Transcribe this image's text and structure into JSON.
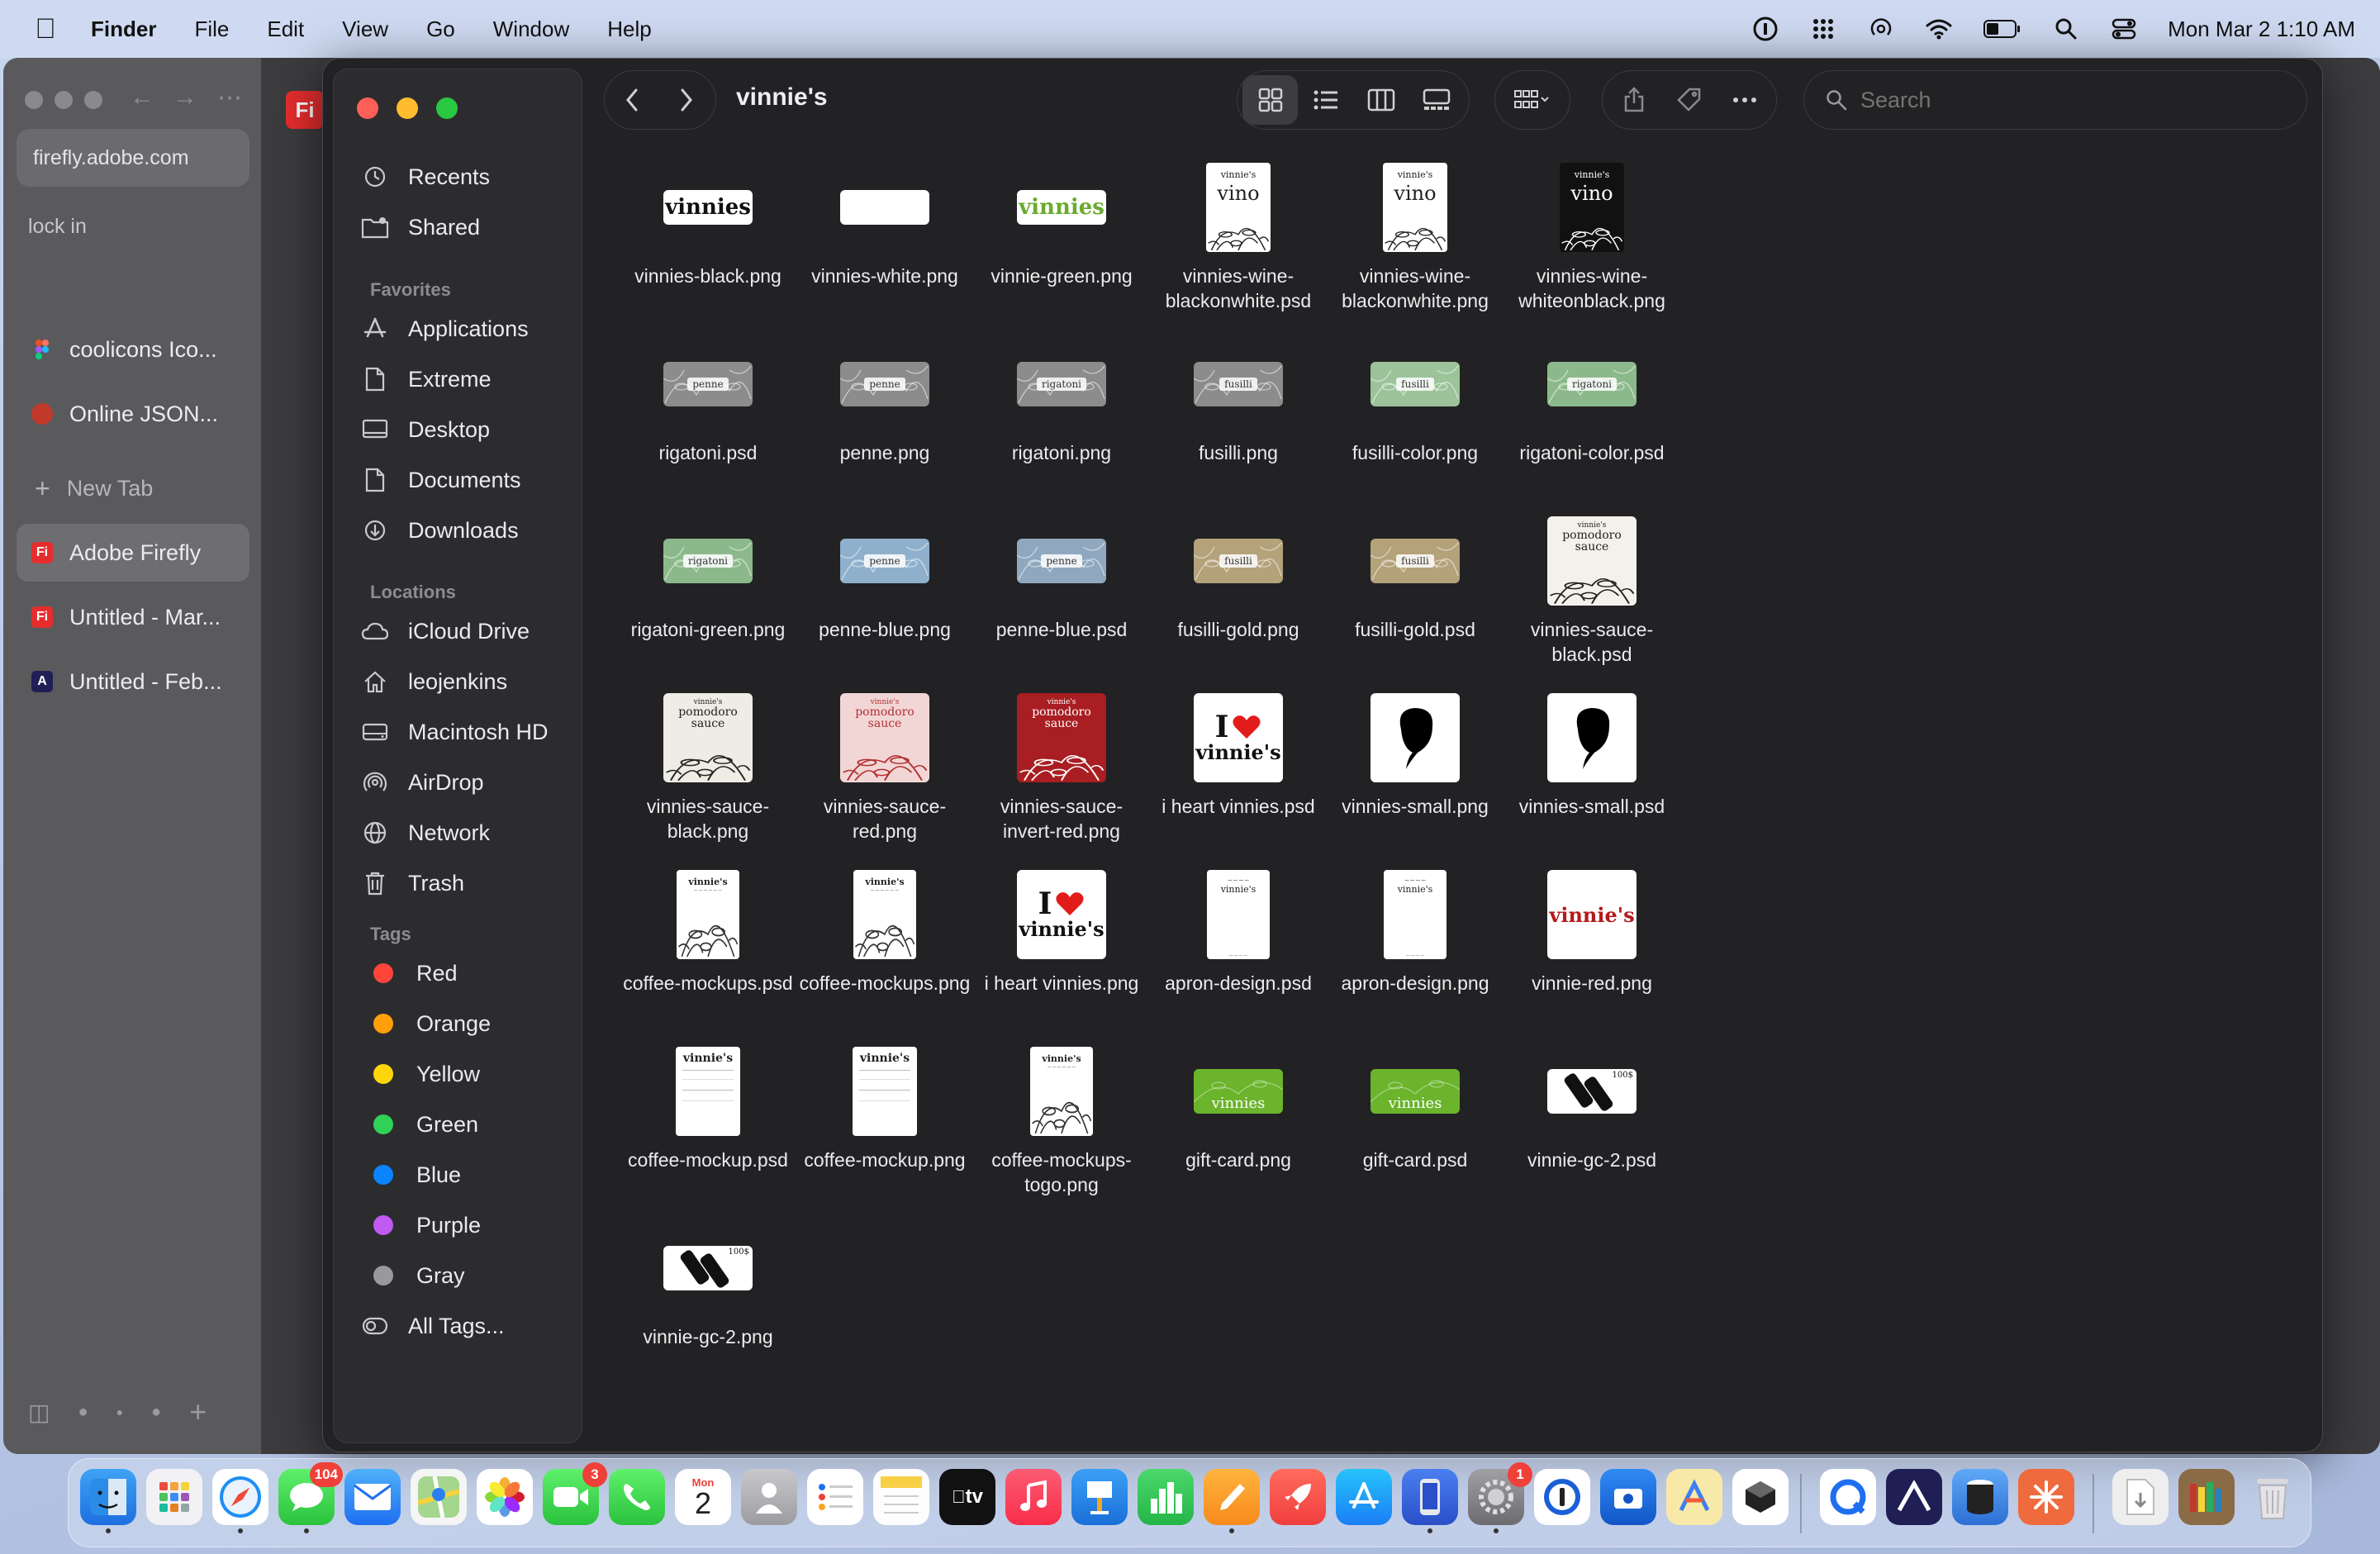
{
  "menubar": {
    "app_name": "Finder",
    "menus": [
      "File",
      "Edit",
      "View",
      "Go",
      "Window",
      "Help"
    ],
    "clock": "Mon Mar 2  1:10 AM"
  },
  "browser": {
    "url": "firefly.adobe.com",
    "section": "lock in",
    "tabs": [
      {
        "label": "coolicons Ico...",
        "color": "#7a54d8"
      },
      {
        "label": "Online JSON...",
        "color": "#c0392b"
      }
    ],
    "new_tab": "New Tab",
    "tabs2": [
      {
        "label": "Adobe Firefly",
        "color": "#e62d2d",
        "badge": "Fi"
      },
      {
        "label": "Untitled - Mar...",
        "color": "#e62d2d",
        "badge": "Fi"
      },
      {
        "label": "Untitled - Feb...",
        "color": "#1f1f55",
        "badge": "A"
      }
    ],
    "content_badge": "Fi"
  },
  "finder": {
    "title": "vinnie's",
    "search_placeholder": "Search",
    "sidebar": {
      "top": [
        {
          "label": "Recents",
          "icon": "clock-icon"
        },
        {
          "label": "Shared",
          "icon": "shared-folder-icon"
        }
      ],
      "favorites_head": "Favorites",
      "favorites": [
        {
          "label": "Applications",
          "icon": "applications-icon"
        },
        {
          "label": "Extreme",
          "icon": "document-icon"
        },
        {
          "label": "Desktop",
          "icon": "desktop-icon"
        },
        {
          "label": "Documents",
          "icon": "document-icon"
        },
        {
          "label": "Downloads",
          "icon": "download-icon"
        }
      ],
      "locations_head": "Locations",
      "locations": [
        {
          "label": "iCloud Drive",
          "icon": "cloud-icon"
        },
        {
          "label": "leojenkins",
          "icon": "home-icon"
        },
        {
          "label": "Macintosh HD",
          "icon": "disk-icon"
        },
        {
          "label": "AirDrop",
          "icon": "airdrop-icon"
        },
        {
          "label": "Network",
          "icon": "globe-icon"
        },
        {
          "label": "Trash",
          "icon": "trash-icon"
        }
      ],
      "tags_head": "Tags",
      "tags": [
        {
          "label": "Red",
          "color": "#ff453a"
        },
        {
          "label": "Orange",
          "color": "#ff9f0a"
        },
        {
          "label": "Yellow",
          "color": "#ffd60a"
        },
        {
          "label": "Green",
          "color": "#30d158"
        },
        {
          "label": "Blue",
          "color": "#0a84ff"
        },
        {
          "label": "Purple",
          "color": "#bf5af2"
        },
        {
          "label": "Gray",
          "color": "#98989d"
        }
      ],
      "all_tags": "All Tags..."
    },
    "files": [
      {
        "name": "vinnies-black.png",
        "kind": "wide-logo",
        "bg": "#ffffff",
        "fg": "#111111",
        "text": "vinnies"
      },
      {
        "name": "vinnies-white.png",
        "kind": "wide-logo",
        "bg": "#ffffff",
        "fg": "#ffffff",
        "text": ""
      },
      {
        "name": "vinnie-green.png",
        "kind": "wide-logo",
        "bg": "#ffffff",
        "fg": "#6aab2e",
        "text": "vinnies"
      },
      {
        "name": "vinnies-wine-blackonwhite.psd",
        "kind": "wine",
        "bg": "#ffffff",
        "fg": "#222222"
      },
      {
        "name": "vinnies-wine-blackonwhite.png",
        "kind": "wine",
        "bg": "#ffffff",
        "fg": "#222222"
      },
      {
        "name": "vinnies-wine-whiteonblack.png",
        "kind": "wine",
        "bg": "#111111",
        "fg": "#ffffff"
      },
      {
        "name": "rigatoni.psd",
        "kind": "pasta",
        "bg": "#8c8c8c",
        "fg": "#ffffff",
        "text": "penne"
      },
      {
        "name": "penne.png",
        "kind": "pasta",
        "bg": "#8c8c8c",
        "fg": "#ffffff",
        "text": "penne"
      },
      {
        "name": "rigatoni.png",
        "kind": "pasta",
        "bg": "#8c8c8c",
        "fg": "#ffffff",
        "text": "rigatoni"
      },
      {
        "name": "fusilli.png",
        "kind": "pasta",
        "bg": "#8c8c8c",
        "fg": "#ffffff",
        "text": "fusilli"
      },
      {
        "name": "fusilli-color.png",
        "kind": "pasta",
        "bg": "#9cc39a",
        "fg": "#ffffff",
        "text": "fusilli"
      },
      {
        "name": "rigatoni-color.psd",
        "kind": "pasta",
        "bg": "#8cb98c",
        "fg": "#ffffff",
        "text": "rigatoni"
      },
      {
        "name": "rigatoni-green.png",
        "kind": "pasta",
        "bg": "#8cb98c",
        "fg": "#ffffff",
        "text": "rigatoni"
      },
      {
        "name": "penne-blue.png",
        "kind": "pasta",
        "bg": "#8fb0cc",
        "fg": "#ffffff",
        "text": "penne"
      },
      {
        "name": "penne-blue.psd",
        "kind": "pasta",
        "bg": "#8fa8bf",
        "fg": "#ffffff",
        "text": "penne"
      },
      {
        "name": "fusilli-gold.png",
        "kind": "pasta",
        "bg": "#b3a27a",
        "fg": "#ffffff",
        "text": "fusilli"
      },
      {
        "name": "fusilli-gold.psd",
        "kind": "pasta",
        "bg": "#b3a27a",
        "fg": "#ffffff",
        "text": "fusilli"
      },
      {
        "name": "vinnies-sauce-black.psd",
        "kind": "sauce",
        "bg": "#f4f1ea",
        "fg": "#222222"
      },
      {
        "name": "vinnies-sauce-black.png",
        "kind": "sauce",
        "bg": "#eeece4",
        "fg": "#222222"
      },
      {
        "name": "vinnies-sauce-red.png",
        "kind": "sauce",
        "bg": "#f2d6d6",
        "fg": "#b23030"
      },
      {
        "name": "vinnies-sauce-invert-red.png",
        "kind": "sauce",
        "bg": "#a81e22",
        "fg": "#ffffff"
      },
      {
        "name": "i heart vinnies.psd",
        "kind": "heart"
      },
      {
        "name": "vinnies-small.png",
        "kind": "small"
      },
      {
        "name": "vinnies-small.psd",
        "kind": "small"
      },
      {
        "name": "coffee-mockups.psd",
        "kind": "coffee"
      },
      {
        "name": "coffee-mockups.png",
        "kind": "coffee"
      },
      {
        "name": "i heart vinnies.png",
        "kind": "heart"
      },
      {
        "name": "apron-design.psd",
        "kind": "apron"
      },
      {
        "name": "apron-design.png",
        "kind": "apron"
      },
      {
        "name": "vinnie-red.png",
        "kind": "wide-square",
        "fg": "#b31b1b",
        "text": "vinnie's"
      },
      {
        "name": "coffee-mockup.psd",
        "kind": "menu"
      },
      {
        "name": "coffee-mockup.png",
        "kind": "menu"
      },
      {
        "name": "coffee-mockups-togo.png",
        "kind": "coffee"
      },
      {
        "name": "gift-card.png",
        "kind": "gift",
        "text": "vinnies"
      },
      {
        "name": "gift-card.psd",
        "kind": "gift",
        "text": "vinnies"
      },
      {
        "name": "vinnie-gc-2.psd",
        "kind": "gc2",
        "text": "100$"
      },
      {
        "name": "vinnie-gc-2.png",
        "kind": "gc2",
        "text": "100$"
      }
    ]
  },
  "wine_label": {
    "small": "vinnie's",
    "big": "vino"
  },
  "sauce_label": {
    "small": "vinnie's",
    "line1": "pomodoro",
    "line2": "sauce"
  },
  "heart_label": {
    "top": "I",
    "bottom": "vinnie's"
  },
  "dock": {
    "messages_badge": "104",
    "facetime_badge": "3",
    "settings_badge": "1",
    "calendar_month": "Mon",
    "calendar_day": "2",
    "tv_label": "tv"
  }
}
